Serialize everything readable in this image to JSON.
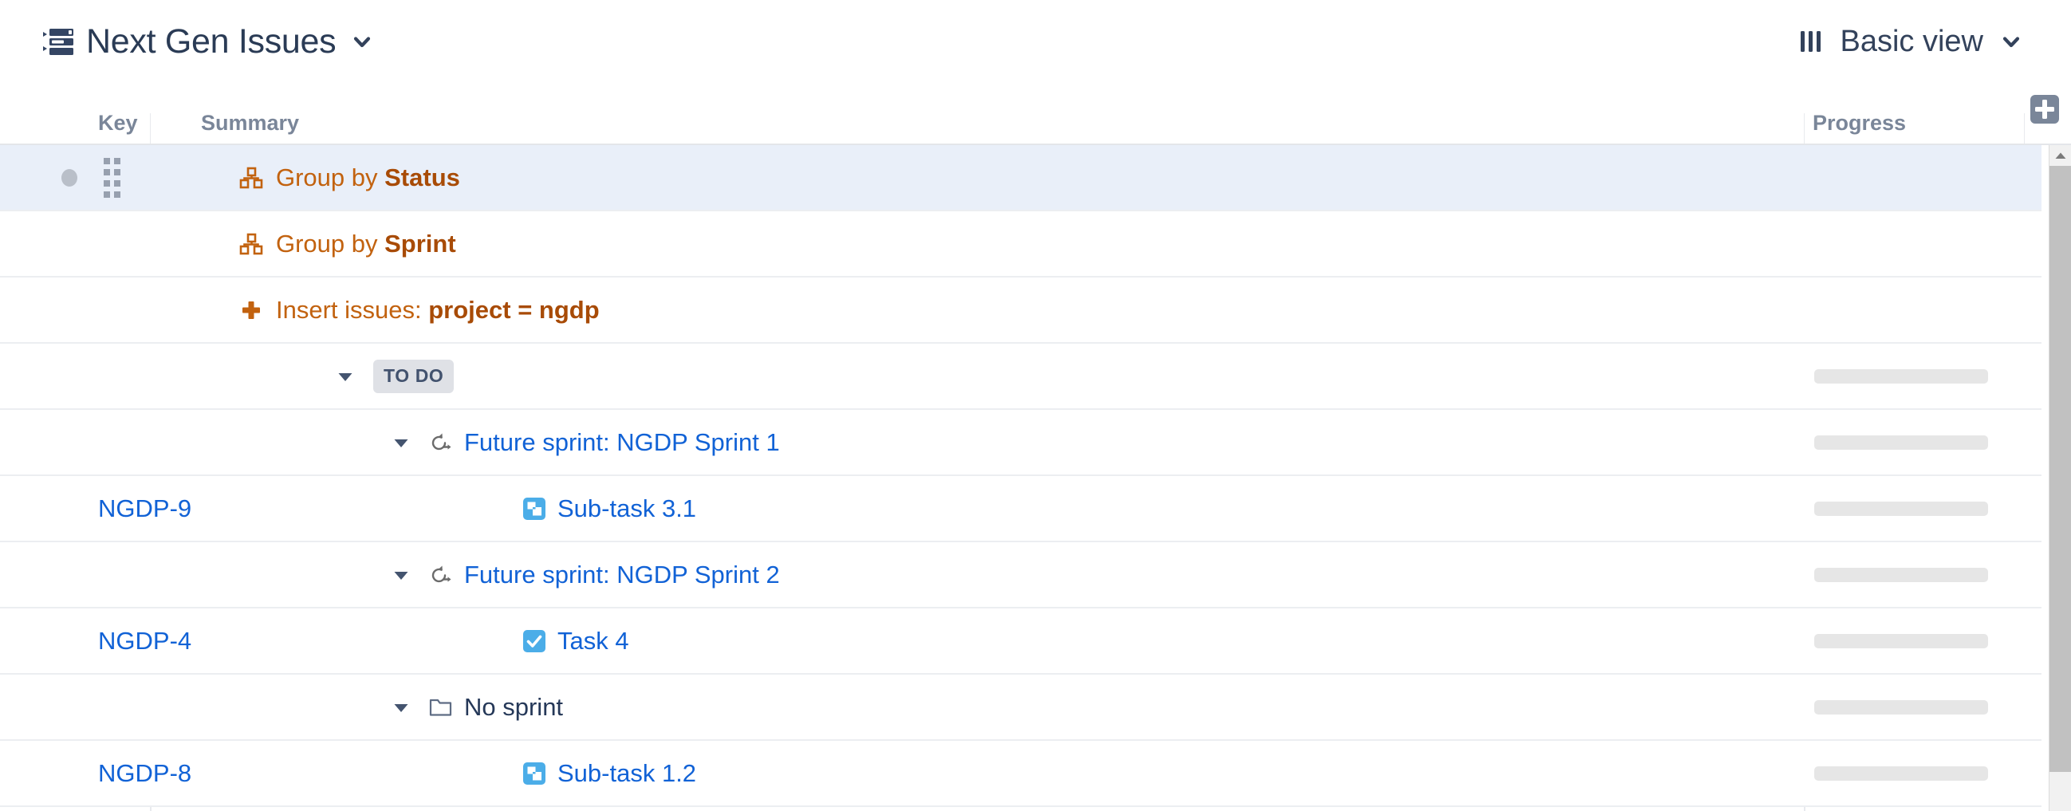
{
  "header": {
    "title": "Next Gen Issues",
    "structure_icon": "structure-tree-icon",
    "title_chevron_icon": "chevron-down-icon",
    "view_icon": "columns-bars-icon",
    "view_label": "Basic view",
    "view_chevron_icon": "chevron-down-icon"
  },
  "columns": {
    "key": "Key",
    "summary": "Summary",
    "progress": "Progress",
    "add_column_icon": "add-column-plus-icon"
  },
  "colors": {
    "generator_orange": "#c2620f",
    "generator_orange_bold": "#a84b06",
    "link_blue": "#1162d6",
    "text_navy": "#253858",
    "header_grey": "#7a8699",
    "selected_row": "#e9eff9",
    "badge_bg": "#dfe1e6",
    "progress_track": "#e6e6e6"
  },
  "rows": [
    {
      "type": "generator",
      "selected": true,
      "indent": 0,
      "key": "",
      "icon": "group-by-icon",
      "prefix": "Group by ",
      "strong": "Status",
      "progress": null,
      "has_bullet": true,
      "has_drag_handle": true
    },
    {
      "type": "generator",
      "selected": false,
      "indent": 0,
      "key": "",
      "icon": "group-by-icon",
      "prefix": "Group by ",
      "strong": "Sprint",
      "progress": null,
      "has_bullet": false,
      "has_drag_handle": false
    },
    {
      "type": "generator",
      "selected": false,
      "indent": 0,
      "key": "",
      "icon": "insert-plus-icon",
      "prefix": "Insert issues: ",
      "strong": "project = ngdp",
      "progress": null,
      "has_bullet": false,
      "has_drag_handle": false
    },
    {
      "type": "status-group",
      "selected": false,
      "indent": 1,
      "key": "",
      "twisty": "twisty-expanded-icon",
      "badge": "TO DO",
      "progress": 0,
      "has_bullet": false,
      "has_drag_handle": false
    },
    {
      "type": "sprint-group",
      "selected": false,
      "indent": 2,
      "key": "",
      "twisty": "twisty-expanded-icon",
      "icon": "sprint-icon",
      "label": "Future sprint: NGDP Sprint 1",
      "progress": 0,
      "has_bullet": false,
      "has_drag_handle": false
    },
    {
      "type": "issue",
      "selected": false,
      "indent": 3,
      "key": "NGDP-9",
      "icon": "sub-task-icon",
      "label": "Sub-task 3.1",
      "progress": 0,
      "has_bullet": false,
      "has_drag_handle": false
    },
    {
      "type": "sprint-group",
      "selected": false,
      "indent": 2,
      "key": "",
      "twisty": "twisty-expanded-icon",
      "icon": "sprint-icon",
      "label": "Future sprint: NGDP Sprint 2",
      "progress": 0,
      "has_bullet": false,
      "has_drag_handle": false
    },
    {
      "type": "issue",
      "selected": false,
      "indent": 3,
      "key": "NGDP-4",
      "icon": "task-icon",
      "label": "Task 4",
      "progress": 0,
      "has_bullet": false,
      "has_drag_handle": false
    },
    {
      "type": "sprint-group",
      "selected": false,
      "indent": 2,
      "key": "",
      "twisty": "twisty-expanded-icon",
      "icon": "folder-icon",
      "label": "No sprint",
      "progress": 0,
      "has_bullet": false,
      "has_drag_handle": false
    },
    {
      "type": "issue",
      "selected": false,
      "indent": 3,
      "key": "NGDP-8",
      "icon": "sub-task-icon",
      "label": "Sub-task 1.2",
      "progress": 0,
      "has_bullet": false,
      "has_drag_handle": false
    }
  ],
  "scrollbar": {
    "up_arrow_icon": "scroll-up-arrow-icon",
    "thumb": "scroll-thumb"
  }
}
